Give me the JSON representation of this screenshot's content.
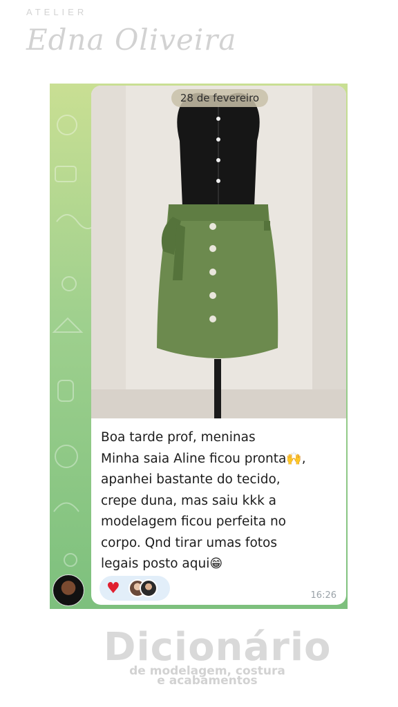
{
  "brand_top": {
    "small": "ATELIER",
    "script": "Edna Oliveira"
  },
  "chat": {
    "date_pill": "28 de fevereiro",
    "message_lines": [
      "Boa tarde prof, meninas",
      "Minha saia Aline ficou pronta",
      "apanhei bastante do tecido,",
      "crepe duna, mas saiu kkk a",
      "modelagem ficou perfeita no",
      "corpo. Qnd tirar umas fotos",
      "legais posto aqui"
    ],
    "emoji_raised_hands": "🙌",
    "emoji_trailing_comma": ",",
    "emoji_grin": "😁",
    "reaction_heart": "♥",
    "time": "16:26",
    "colors": {
      "bubble": "#ffffff",
      "skirt": "#6c8a4e",
      "reaction_bg": "#e2eef9"
    }
  },
  "brand_bottom": {
    "title": "Dicionário",
    "sub1": "de modelagem, costura",
    "sub2": "e acabamentos"
  }
}
